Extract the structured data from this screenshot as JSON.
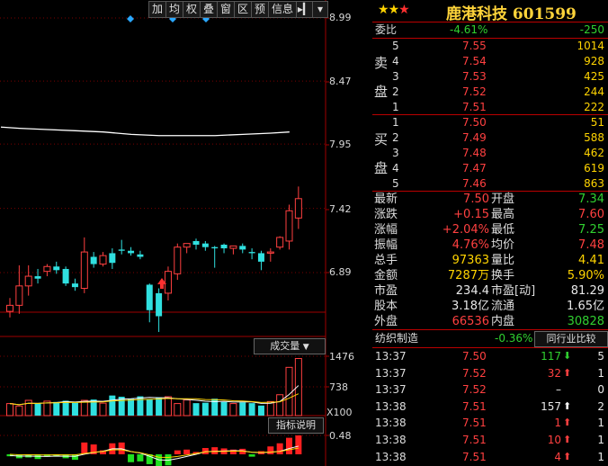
{
  "toolbar": {
    "items": [
      "加",
      "均",
      "权",
      "叠",
      "窗",
      "区",
      "预",
      "信息"
    ],
    "menu_icon": "menu-collapse-icon",
    "dropdown_icon": "triangle-down-icon"
  },
  "price_axis": [
    "8.99",
    "8.47",
    "7.95",
    "7.42",
    "6.89"
  ],
  "volume_axis": [
    "1476",
    "738",
    "X100"
  ],
  "indicator_axis": [
    "0.48"
  ],
  "panel_buttons": {
    "volume": "成交量",
    "indicator": "指标说明"
  },
  "colors": {
    "up": "#ff4040",
    "down": "#30e0e0",
    "ma": "#ffffff",
    "grid": "#8b0000"
  },
  "header": {
    "title": "鹿港科技 601599",
    "stars_filled": 3
  },
  "weibi": {
    "label": "委比",
    "pct": "-4.61%",
    "diff": "-250"
  },
  "sell_label": [
    "卖",
    "盘"
  ],
  "buy_label": [
    "买",
    "盘"
  ],
  "asks": [
    {
      "lvl": "5",
      "price": "7.55",
      "vol": "1014"
    },
    {
      "lvl": "4",
      "price": "7.54",
      "vol": "928"
    },
    {
      "lvl": "3",
      "price": "7.53",
      "vol": "425"
    },
    {
      "lvl": "2",
      "price": "7.52",
      "vol": "244"
    },
    {
      "lvl": "1",
      "price": "7.51",
      "vol": "222"
    }
  ],
  "bids": [
    {
      "lvl": "1",
      "price": "7.50",
      "vol": "51"
    },
    {
      "lvl": "2",
      "price": "7.49",
      "vol": "588"
    },
    {
      "lvl": "3",
      "price": "7.48",
      "vol": "462"
    },
    {
      "lvl": "4",
      "price": "7.47",
      "vol": "619"
    },
    {
      "lvl": "5",
      "price": "7.46",
      "vol": "863"
    }
  ],
  "quote": [
    {
      "l1": "最新",
      "v1": "7.50",
      "l2": "开盘",
      "v2": "7.34"
    },
    {
      "l1": "涨跌",
      "v1": "+0.15",
      "l2": "最高",
      "v2": "7.60"
    },
    {
      "l1": "涨幅",
      "v1": "+2.04%",
      "l2": "最低",
      "v2": "7.25"
    },
    {
      "l1": "振幅",
      "v1": "4.76%",
      "l2": "均价",
      "v2": "7.48"
    },
    {
      "l1": "总手",
      "v1": "97363",
      "l2": "量比",
      "v2": "4.41"
    },
    {
      "l1": "金额",
      "v1": "7287万",
      "l2": "换手",
      "v2": "5.90%"
    },
    {
      "l1": "市盈",
      "v1": "234.4",
      "l2": "市盈[动]",
      "v2": "81.29"
    },
    {
      "l1": "股本",
      "v1": "3.18亿",
      "l2": "流通",
      "v2": "1.65亿"
    },
    {
      "l1": "外盘",
      "v1": "66536",
      "l2": "内盘",
      "v2": "30828"
    }
  ],
  "industry": {
    "name": "纺织制造",
    "pct": "-0.36%",
    "compare_btn": "同行业比较"
  },
  "ticks": [
    {
      "time": "13:37",
      "price": "7.50",
      "vol": "117",
      "dir": "down",
      "n": "5"
    },
    {
      "time": "13:37",
      "price": "7.52",
      "vol": "32",
      "dir": "up",
      "n": "1"
    },
    {
      "time": "13:37",
      "price": "7.52",
      "vol": "–",
      "dir": "none",
      "n": "0"
    },
    {
      "time": "13:38",
      "price": "7.51",
      "vol": "157",
      "dir": "upw",
      "n": "2"
    },
    {
      "time": "13:38",
      "price": "7.51",
      "vol": "1",
      "dir": "up",
      "n": "1"
    },
    {
      "time": "13:38",
      "price": "7.51",
      "vol": "10",
      "dir": "up",
      "n": "1"
    },
    {
      "time": "13:38",
      "price": "7.51",
      "vol": "4",
      "dir": "up",
      "n": "1"
    }
  ],
  "chart_data": {
    "type": "candlestick",
    "title": "",
    "y_axis_ticks": [
      8.99,
      8.47,
      7.95,
      7.42,
      6.89
    ],
    "ylim": [
      6.35,
      9.05
    ],
    "candles": [
      {
        "o": 6.57,
        "h": 6.68,
        "l": 6.52,
        "c": 6.62
      },
      {
        "o": 6.62,
        "h": 6.95,
        "l": 6.55,
        "c": 6.78
      },
      {
        "o": 6.78,
        "h": 6.95,
        "l": 6.7,
        "c": 6.86
      },
      {
        "o": 6.86,
        "h": 6.92,
        "l": 6.8,
        "c": 6.84
      },
      {
        "o": 6.9,
        "h": 6.96,
        "l": 6.86,
        "c": 6.94
      },
      {
        "o": 6.94,
        "h": 6.98,
        "l": 6.88,
        "c": 6.91
      },
      {
        "o": 6.92,
        "h": 6.94,
        "l": 6.78,
        "c": 6.8
      },
      {
        "o": 6.8,
        "h": 6.84,
        "l": 6.74,
        "c": 6.77
      },
      {
        "o": 6.76,
        "h": 7.18,
        "l": 6.72,
        "c": 7.06
      },
      {
        "o": 7.02,
        "h": 7.06,
        "l": 6.93,
        "c": 6.96
      },
      {
        "o": 6.96,
        "h": 7.06,
        "l": 6.94,
        "c": 7.03
      },
      {
        "o": 7.05,
        "h": 7.09,
        "l": 6.92,
        "c": 6.97
      },
      {
        "o": 7.08,
        "h": 7.16,
        "l": 7.04,
        "c": 7.07
      },
      {
        "o": 7.07,
        "h": 7.1,
        "l": 7.03,
        "c": 7.05
      },
      {
        "o": 7.04,
        "h": 7.07,
        "l": 7.0,
        "c": 7.02
      },
      {
        "o": 6.79,
        "h": 6.8,
        "l": 6.48,
        "c": 6.58
      },
      {
        "o": 6.72,
        "h": 6.76,
        "l": 6.4,
        "c": 6.53
      },
      {
        "o": 6.72,
        "h": 6.94,
        "l": 6.66,
        "c": 6.9
      },
      {
        "o": 6.88,
        "h": 7.13,
        "l": 6.83,
        "c": 7.1
      },
      {
        "o": 7.1,
        "h": 7.13,
        "l": 7.05,
        "c": 7.13
      },
      {
        "o": 7.15,
        "h": 7.17,
        "l": 7.08,
        "c": 7.12
      },
      {
        "o": 7.13,
        "h": 7.15,
        "l": 7.07,
        "c": 7.1
      },
      {
        "o": 7.1,
        "h": 7.11,
        "l": 6.93,
        "c": 7.09
      },
      {
        "o": 7.12,
        "h": 7.13,
        "l": 7.05,
        "c": 7.09
      },
      {
        "o": 7.09,
        "h": 7.11,
        "l": 7.04,
        "c": 7.11
      },
      {
        "o": 7.11,
        "h": 7.13,
        "l": 7.05,
        "c": 7.08
      },
      {
        "o": 7.06,
        "h": 7.09,
        "l": 7.0,
        "c": 7.05
      },
      {
        "o": 7.05,
        "h": 7.07,
        "l": 6.91,
        "c": 6.98
      },
      {
        "o": 7.05,
        "h": 7.09,
        "l": 6.98,
        "c": 7.06
      },
      {
        "o": 7.1,
        "h": 7.19,
        "l": 7.08,
        "c": 7.18
      },
      {
        "o": 7.15,
        "h": 7.45,
        "l": 7.08,
        "c": 7.4
      },
      {
        "o": 7.34,
        "h": 7.6,
        "l": 7.25,
        "c": 7.5
      }
    ],
    "ma_line": [
      {
        "i": 0,
        "v": 8.09
      },
      {
        "i": 2,
        "v": 8.08
      },
      {
        "i": 5,
        "v": 8.07
      },
      {
        "i": 8,
        "v": 8.06
      },
      {
        "i": 11,
        "v": 8.05
      },
      {
        "i": 14,
        "v": 8.03
      },
      {
        "i": 17,
        "v": 8.02
      },
      {
        "i": 20,
        "v": 8.02
      },
      {
        "i": 23,
        "v": 8.02
      },
      {
        "i": 26,
        "v": 8.03
      },
      {
        "i": 29,
        "v": 8.04
      },
      {
        "i": 31,
        "v": 8.05
      }
    ],
    "volume": {
      "ticks": [
        1476,
        738
      ],
      "max": 1476,
      "values": [
        300,
        240,
        380,
        300,
        360,
        340,
        370,
        320,
        380,
        400,
        310,
        500,
        470,
        420,
        480,
        400,
        450,
        470,
        300,
        390,
        310,
        320,
        420,
        340,
        300,
        330,
        310,
        250,
        350,
        520,
        1200,
        1420
      ]
    },
    "indicator": {
      "ticks": [
        0.48
      ],
      "values": [
        -0.05,
        -0.1,
        -0.08,
        -0.12,
        -0.06,
        -0.05,
        -0.1,
        -0.14,
        0.3,
        0.25,
        0.1,
        0.28,
        0.3,
        -0.2,
        -0.18,
        -0.25,
        -0.3,
        -0.28,
        0.1,
        0.12,
        0.06,
        0.16,
        0.18,
        0.15,
        0.12,
        0.14,
        -0.06,
        0.08,
        0.2,
        0.28,
        0.42,
        0.48
      ]
    }
  }
}
